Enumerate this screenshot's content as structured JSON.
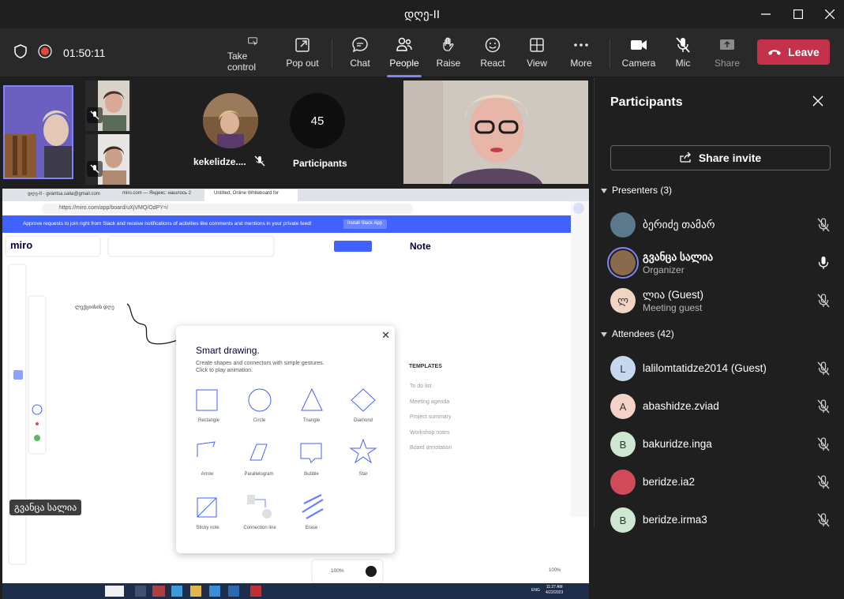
{
  "window": {
    "title": "დღე-II"
  },
  "meeting": {
    "timer": "01:50:11"
  },
  "toolbar": {
    "take_control": "Take control",
    "pop_out": "Pop out",
    "chat": "Chat",
    "people": "People",
    "raise": "Raise",
    "react": "React",
    "view": "View",
    "more": "More",
    "camera": "Camera",
    "mic": "Mic",
    "share": "Share",
    "leave": "Leave"
  },
  "stage": {
    "kekelidze_name": "kekelidze....",
    "participants_count": "45",
    "participants_label": "Participants",
    "presenter_tag": "გვანცა სალია"
  },
  "browser": {
    "tabs": [
      "დღე-II - gvantsa.salia@gmail.com",
      "miro.com — Яндекс: нашлось 2",
      "Untitled, Online Whiteboard for"
    ],
    "url": "https://miro.com/app/board/uXjVMQ/OdPY=/",
    "slack_banner": "Approve requests to join right from Slack and receive notifications of activities like comments and mentions in your private feed!",
    "slack_button": "Install Slack App"
  },
  "miro": {
    "logo": "miro",
    "note_label": "Note",
    "canvas_text": "ლექციისის დღე",
    "templates_title": "TEMPLATES",
    "templates": [
      "To do list",
      "Meeting agenda",
      "Project summary",
      "Workshop notes",
      "Board annotation"
    ],
    "zoom": "100%",
    "zoom_right": "100%"
  },
  "modal": {
    "title": "Smart drawing.",
    "desc1": "Create shapes and connectors with simple gestures.",
    "desc2": "Click to play animation.",
    "shapes": [
      "Rectangle",
      "Circle",
      "Triangle",
      "Diamond",
      "Arrow",
      "Parallelogram",
      "Bubble",
      "Star",
      "Sticky note",
      "Connection line",
      "Erase"
    ]
  },
  "taskbar": {
    "time": "11:27 AM",
    "date": "4/22/2023",
    "lang": "ENG"
  },
  "panel": {
    "title": "Participants",
    "share_invite": "Share invite",
    "presenters_header": "Presenters (3)",
    "attendees_header": "Attendees (42)",
    "presenters": [
      {
        "name": "ბერიძე თამარ",
        "sub": "",
        "initial": "",
        "avatar_color": "#5a7a8c",
        "mic": "muted"
      },
      {
        "name": "გვანცა სალია",
        "sub": "Organizer",
        "initial": "",
        "avatar_color": "#8a6a4a",
        "mic": "on"
      },
      {
        "name": "ლია (Guest)",
        "sub": "Meeting guest",
        "initial": "ლ",
        "avatar_color": "#f2d4c4",
        "mic": "muted"
      }
    ],
    "attendees": [
      {
        "name": "lalilomtatidze2014 (Guest)",
        "initial": "L",
        "avatar_color": "#c6d7ee",
        "mic": "muted"
      },
      {
        "name": "abashidze.zviad",
        "initial": "A",
        "avatar_color": "#f4d2c7",
        "mic": "muted"
      },
      {
        "name": "bakuridze.inga",
        "initial": "B",
        "avatar_color": "#cfe7d1",
        "mic": "muted"
      },
      {
        "name": "beridze.ia2",
        "initial": "",
        "avatar_color": "#d04a5a",
        "mic": "muted"
      },
      {
        "name": "beridze.irma3",
        "initial": "B",
        "avatar_color": "#cfe7d1",
        "mic": "muted"
      }
    ]
  },
  "colors": {
    "accent": "#7f85f5",
    "leave": "#c4314b",
    "miro_blue": "#4262ff"
  }
}
